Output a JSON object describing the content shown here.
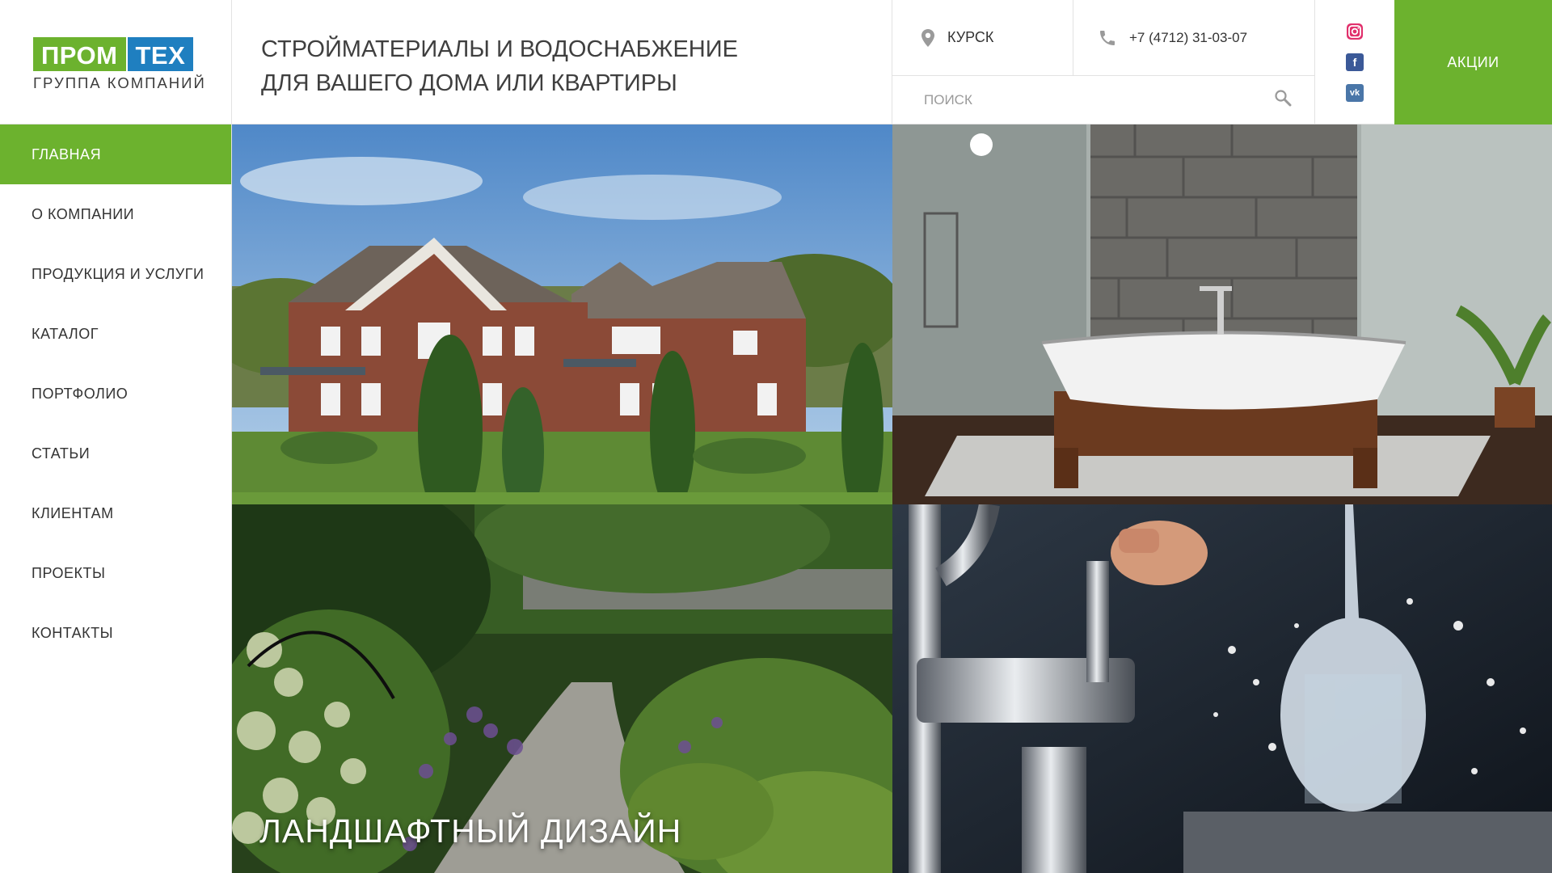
{
  "logo": {
    "left": "ПРОМ",
    "right": "ТЕХ",
    "subtitle": "ГРУППА КОМПАНИЙ"
  },
  "header": {
    "tagline_line1": "СТРОЙМАТЕРИАЛЫ И ВОДОСНАБЖЕНИЕ",
    "tagline_line2": "ДЛЯ ВАШЕГО ДОМА ИЛИ КВАРТИРЫ",
    "city": "КУРСК",
    "phone": "+7 (4712) 31-03-07",
    "search_placeholder": "ПОИСК",
    "promo_label": "АКЦИИ",
    "socials": [
      {
        "name": "instagram-icon"
      },
      {
        "name": "facebook-icon",
        "glyph": "f"
      },
      {
        "name": "vk-icon",
        "glyph": "vk"
      }
    ]
  },
  "nav": {
    "items": [
      {
        "label": "ГЛАВНАЯ",
        "active": true
      },
      {
        "label": "О КОМПАНИИ"
      },
      {
        "label": "ПРОДУКЦИЯ И УСЛУГИ"
      },
      {
        "label": "КАТАЛОГ"
      },
      {
        "label": "ПОРТФОЛИО"
      },
      {
        "label": "СТАТЬИ"
      },
      {
        "label": "КЛИЕНТАМ"
      },
      {
        "label": "ПРОЕКТЫ"
      },
      {
        "label": "КОНТАКТЫ"
      }
    ]
  },
  "tiles": {
    "house_caption": "",
    "bath_caption": "",
    "garden_caption": "ЛАНДШАФТНЫЙ ДИЗАЙН",
    "tap_caption": ""
  },
  "colors": {
    "brand_green": "#6cb22e",
    "brand_blue": "#1f7fc0",
    "instagram": "#e1306c",
    "facebook": "#3b5998",
    "vk": "#4a76a8"
  }
}
